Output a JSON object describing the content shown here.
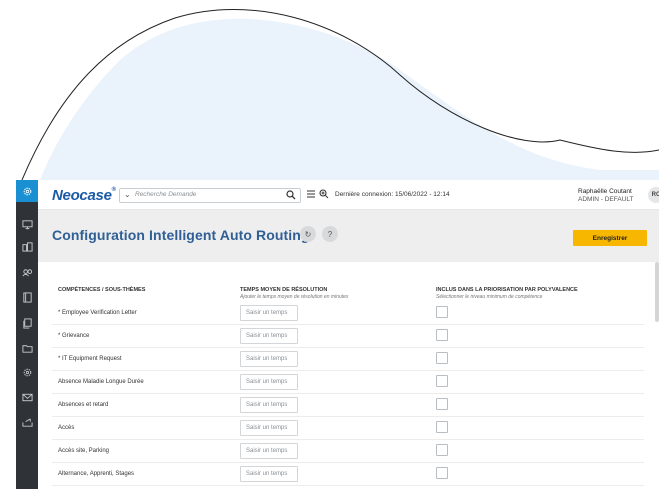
{
  "app": {
    "logo": "Neocase",
    "logo_mark": "®"
  },
  "search": {
    "placeholder": "Recherche Demande"
  },
  "header": {
    "last_login": "Dernière connexion: 15/06/2022 - 12:14",
    "user_name": "Raphaëlle Coutant",
    "user_role": "ADMIN - DEFAULT",
    "user_initials": "RC"
  },
  "page": {
    "title": "Configuration Intelligent Auto Routing",
    "refresh_icon": "↻",
    "help_label": "?",
    "save_label": "Enregistrer"
  },
  "table": {
    "col1_title": "COMPÉTENCES / SOUS-THÈMES",
    "col2_title": "TEMPS MOYEN DE RÉSOLUTION",
    "col2_sub": "Ajouter le temps moyen de résolution en minutes",
    "col3_title": "INCLUS DANS LA PRIORISATION PAR POLYVALENCE",
    "col3_sub": "Sélectionner le niveau minimum de compétence",
    "time_placeholder": "Saisir un temps",
    "rows": [
      {
        "label": "* Employee Verification Letter"
      },
      {
        "label": "* Grievance"
      },
      {
        "label": "* IT Equipment Request"
      },
      {
        "label": "Absence Maladie Longue Durée"
      },
      {
        "label": "Absences et retard"
      },
      {
        "label": "Accès"
      },
      {
        "label": "Accès site, Parking"
      },
      {
        "label": "Alternance, Apprenti, Stages"
      }
    ]
  },
  "colors": {
    "sidebar": "#2f3337",
    "active": "#1a8fd1",
    "title": "#2f5f95",
    "save": "#f7b700"
  }
}
